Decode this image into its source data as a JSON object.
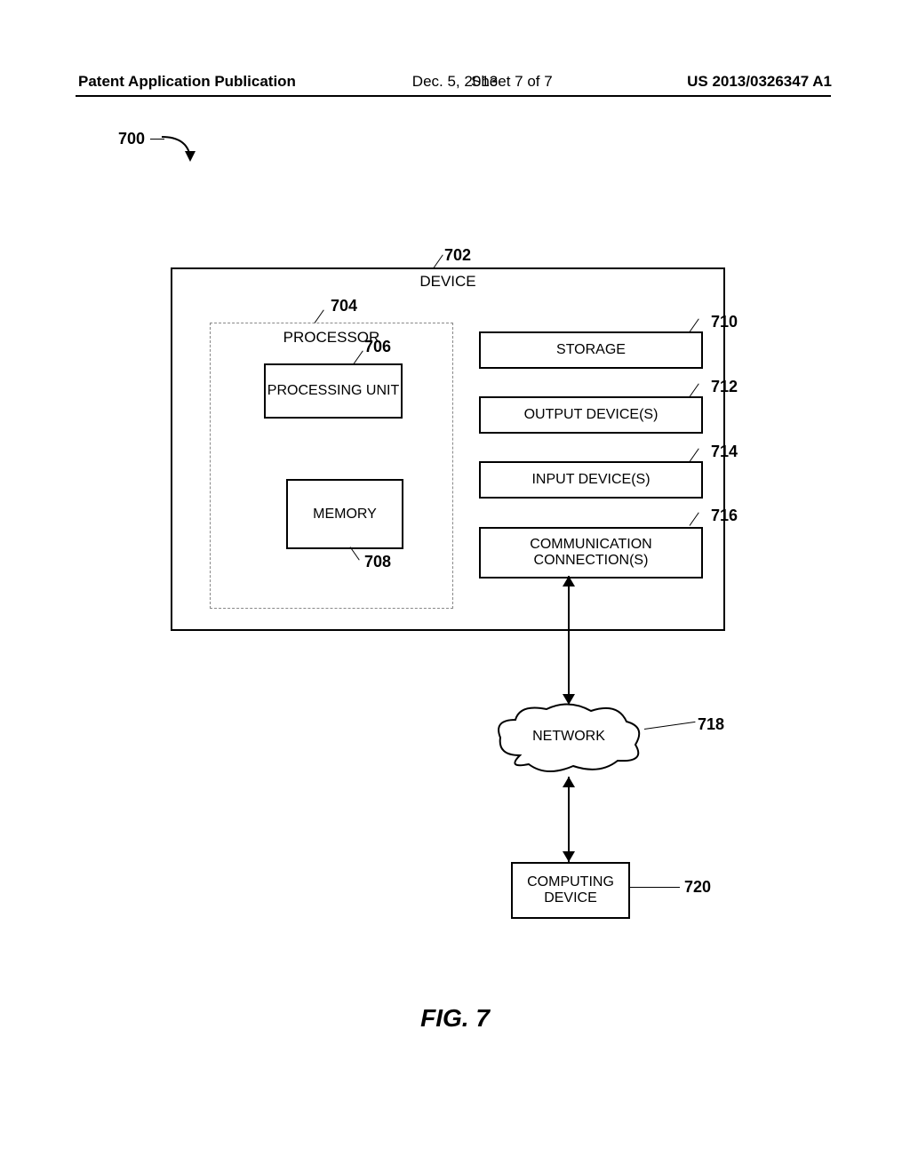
{
  "header": {
    "left": "Patent Application Publication",
    "date": "Dec. 5, 2013",
    "sheet": "Sheet 7 of 7",
    "pubno": "US 2013/0326347 A1"
  },
  "figure": {
    "label": "FIG. 7",
    "ref_700": "700",
    "device": {
      "label": "DEVICE",
      "ref": "702"
    },
    "processor": {
      "label": "PROCESSOR",
      "ref": "704"
    },
    "processing_unit": {
      "label": "PROCESSING UNIT",
      "ref": "706"
    },
    "memory": {
      "label": "MEMORY",
      "ref": "708"
    },
    "storage": {
      "label": "STORAGE",
      "ref": "710"
    },
    "output": {
      "label": "OUTPUT DEVICE(S)",
      "ref": "712"
    },
    "input": {
      "label": "INPUT DEVICE(S)",
      "ref": "714"
    },
    "comm": {
      "label": "COMMUNICATION CONNECTION(S)",
      "ref": "716"
    },
    "network": {
      "label": "NETWORK",
      "ref": "718"
    },
    "computing_device": {
      "label": "COMPUTING DEVICE",
      "ref": "720"
    }
  }
}
